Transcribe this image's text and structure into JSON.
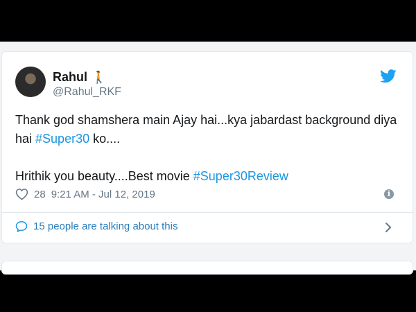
{
  "tweet": {
    "author_name": "Rahul",
    "author_emoji": "🚶",
    "handle": "@Rahul_RKF",
    "text_line1_plain": "Thank god shamshera main Ajay hai...kya jabardast background diya hai ",
    "text_line1_hashtag": "#Super30",
    "text_line1_tail": " ko....",
    "text_line2_plain": "Hrithik you beauty....Best movie ",
    "text_line2_hashtag": "#Super30Review",
    "likes": "28",
    "timestamp": "9:21 AM - Jul 12, 2019",
    "info_glyph": "i",
    "talking": "15 people are talking about this"
  },
  "icons": {
    "avatar": "profile-photo",
    "bird": "twitter-bird-icon",
    "heart": "heart-icon",
    "info": "info-icon",
    "bubble": "speech-bubble-icon",
    "chevron": "chevron-right-icon"
  },
  "colors": {
    "link": "#1b95e0",
    "text": "#14171a",
    "muted": "#657786",
    "twitter_blue": "#1da1f2"
  }
}
